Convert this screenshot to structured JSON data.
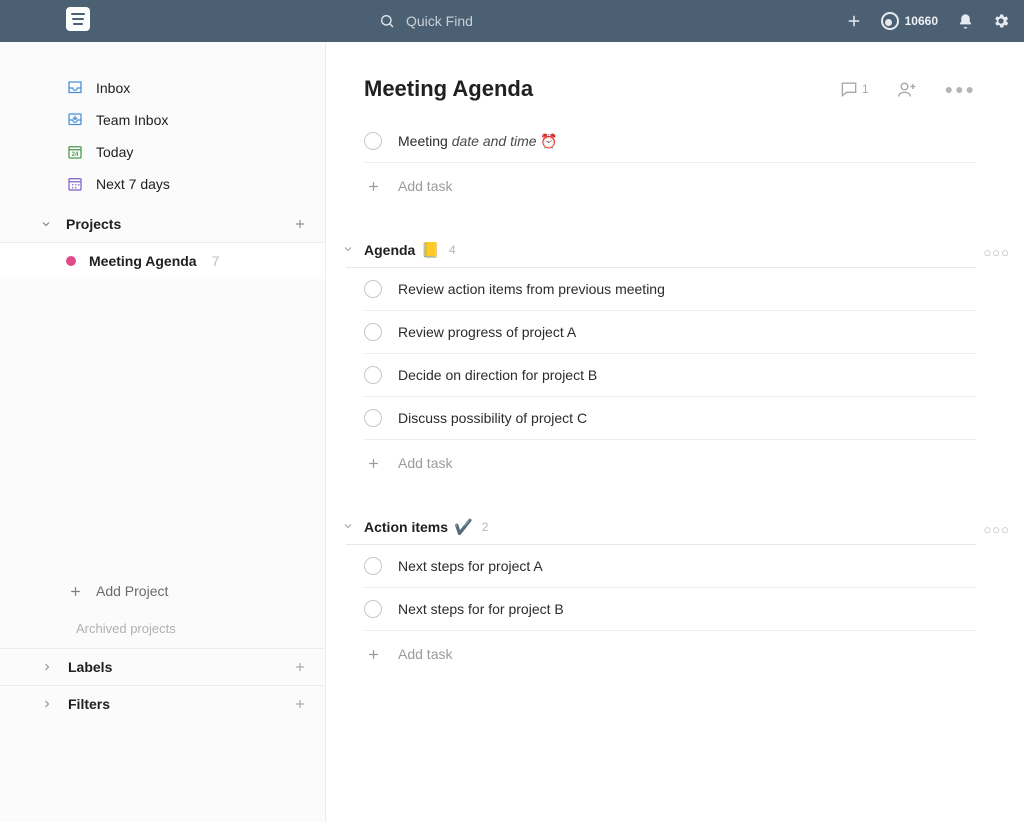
{
  "topbar": {
    "search_placeholder": "Quick Find",
    "karma_points": "10660"
  },
  "sidebar": {
    "nav": [
      {
        "icon": "inbox",
        "label": "Inbox",
        "color": "#4a90d9"
      },
      {
        "icon": "teaminbox",
        "label": "Team Inbox",
        "color": "#4a90d9"
      },
      {
        "icon": "today",
        "label": "Today",
        "color": "#4a9b4a"
      },
      {
        "icon": "calendar",
        "label": "Next 7 days",
        "color": "#7b5dc7"
      }
    ],
    "projects_label": "Projects",
    "projects": [
      {
        "name": "Meeting Agenda",
        "count": "7",
        "color": "#e24a8b"
      }
    ],
    "add_project_label": "Add Project",
    "archived_label": "Archived projects",
    "labels_label": "Labels",
    "filters_label": "Filters"
  },
  "page": {
    "title": "Meeting Agenda",
    "comment_count": "1",
    "sections": [
      {
        "id": "top",
        "emoji": "",
        "count": "",
        "tasks": [
          {
            "title_html": "Meeting <em>date and time</em> ⏰"
          }
        ],
        "add_label": "Add task"
      },
      {
        "id": "agenda",
        "title": "Agenda",
        "emoji": "📒",
        "count": "4",
        "tasks": [
          {
            "title_html": "Review action items from previous meeting"
          },
          {
            "title_html": "Review progress of project A"
          },
          {
            "title_html": "Decide on direction for project B"
          },
          {
            "title_html": "Discuss possibility of project C"
          }
        ],
        "add_label": "Add task"
      },
      {
        "id": "action",
        "title": "Action items",
        "emoji": "✔️",
        "count": "2",
        "tasks": [
          {
            "title_html": "Next steps for project A"
          },
          {
            "title_html": "Next steps for for project B"
          }
        ],
        "add_label": "Add task"
      }
    ]
  }
}
